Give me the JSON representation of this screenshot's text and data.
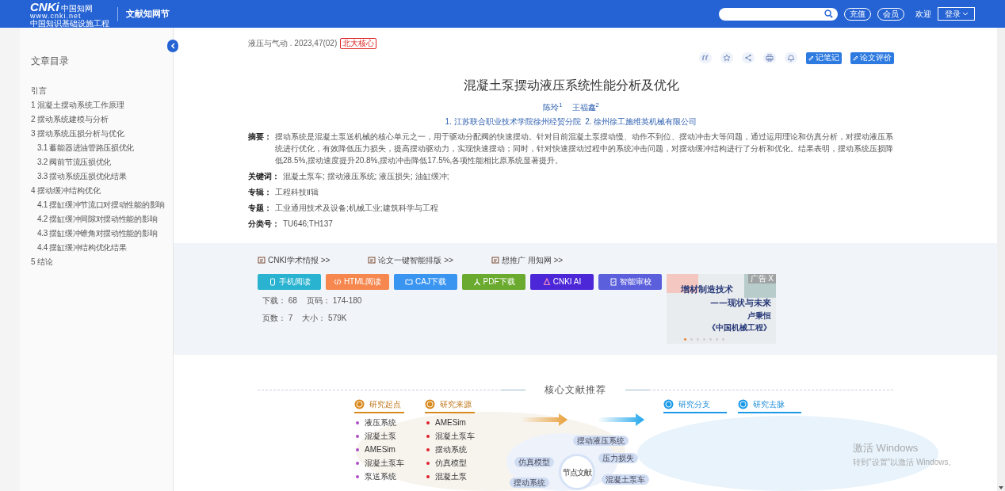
{
  "header": {
    "logo": {
      "mark": "CNKi",
      "cn": "中国知网",
      "url": "www.cnki.net",
      "tagline": "中国知识基础设施工程"
    },
    "section": "文献知网节",
    "buttons": [
      "充值",
      "会员"
    ],
    "welcome": "欢迎",
    "login": "登录"
  },
  "toc": {
    "title": "文章目录",
    "items": [
      {
        "label": "引言"
      },
      {
        "label": "1 混凝土摆动系统工作原理"
      },
      {
        "label": "2 摆动系统建模与分析"
      },
      {
        "label": "3 摆动系统压损分析与优化",
        "children": [
          {
            "label": "3.1 蓄能器进油管路压损优化"
          },
          {
            "label": "3.2 阀前节流压损优化"
          },
          {
            "label": "3.3 摆动系统压损优化结果"
          }
        ]
      },
      {
        "label": "4 摆动缓冲结构优化",
        "children": [
          {
            "label": "4.1 摆缸缓冲节流口对摆动性能的影响"
          },
          {
            "label": "4.2 摆缸缓冲间隙对摆动性能的影响"
          },
          {
            "label": "4.3 摆缸缓冲锥角对摆动性能的影响"
          },
          {
            "label": "4.4 摆缸缓冲结构优化结果"
          }
        ]
      },
      {
        "label": "5 结论"
      }
    ]
  },
  "article": {
    "source": "液压与气动 . 2023,47(02)",
    "badge": "北大核心",
    "actions": [
      "记笔记",
      "论文评价"
    ],
    "title": "混凝土泵摆动液压系统性能分析及优化",
    "authors": [
      "陈玲$^{1}$",
      "王福鑫$^{2}$"
    ],
    "affiliation": "1. 江苏联合职业技术学院徐州经贸分院  2. 徐州徐工施维英机械有限公司",
    "fields": [
      {
        "label": "摘要：",
        "value": "摆动系统是混凝土泵送机械的核心单元之一，用于驱动分配阀的快速摆动。针对目前混凝土泵摆动慢、动作不到位、摆动冲击大等问题，通过运用理论和仿真分析，对摆动液压系统进行优化，有效降低压力损失，提高摆动驱动力，实现快速摆动；同时，针对快速摆动过程中的系统冲击问题，对摆动缓冲结构进行了分析和优化。结果表明，摆动系统压损降低28.5%,摆动速度提升20.8%,摆动冲击降低17.5%,各项性能相比原系统显著提升。"
      },
      {
        "label": "关键词：",
        "value": "混凝土泵车;  摆动液压系统;  液压损失;  油缸缓冲;"
      },
      {
        "label": "专辑：",
        "value": "工程科技Ⅱ辑"
      },
      {
        "label": "专题：",
        "value": "工业通用技术及设备;机械工业;建筑科学与工程"
      },
      {
        "label": "分类号：",
        "value": "TU646;TH137"
      }
    ]
  },
  "services": {
    "links": [
      "CNKI学术情报 >>",
      "论文一键智能排版 >>",
      "想推广 用知网 >>"
    ],
    "buttons": [
      {
        "kind": "phone",
        "label": "手机阅读",
        "color": "#2ab3d0"
      },
      {
        "kind": "html",
        "label": "HTML阅读",
        "color": "#f5874f"
      },
      {
        "kind": "caj",
        "label": "CAJ下载",
        "color": "#3a95f0"
      },
      {
        "kind": "pdf",
        "label": "PDF下载",
        "color": "#6aaa2e"
      },
      {
        "kind": "ai",
        "label": "CNKI AI",
        "color": "#4c27d8"
      },
      {
        "kind": "check",
        "label": "智能审校",
        "color": "#5b5fdc"
      }
    ],
    "stats": [
      [
        "下载：",
        "68",
        "页码：",
        "174-180"
      ],
      [
        "页数：",
        "7",
        "大小：",
        "579K"
      ]
    ],
    "ad": {
      "tag": "广告 X",
      "line1": "增材制造技术",
      "line2": "——现状与未来",
      "author": "卢秉恒",
      "journal": "《中国机械工程》"
    }
  },
  "recommend": {
    "title": "核心文献推荐",
    "columns": [
      {
        "title": "研究起点",
        "color": "#b04cc8",
        "items": [
          "液压系统",
          "混凝土泵",
          "AMESim",
          "混凝土泵车",
          "泵送系统"
        ]
      },
      {
        "title": "研究来源",
        "color": "#e0202c",
        "items": [
          "AMESim",
          "混凝土泵车",
          "摆动系统",
          "仿真模型",
          "混凝土泵"
        ]
      },
      {
        "title": "研究分支"
      },
      {
        "title": "研究去脉"
      }
    ],
    "center": "节点文献",
    "bubbles": [
      "摆动液压系统",
      "仿真模型",
      "压力损失",
      "混凝土泵车",
      "摆动系统"
    ]
  },
  "os_notice": {
    "title": "激活 Windows",
    "text": "转到\"设置\"以激活 Windows。"
  }
}
